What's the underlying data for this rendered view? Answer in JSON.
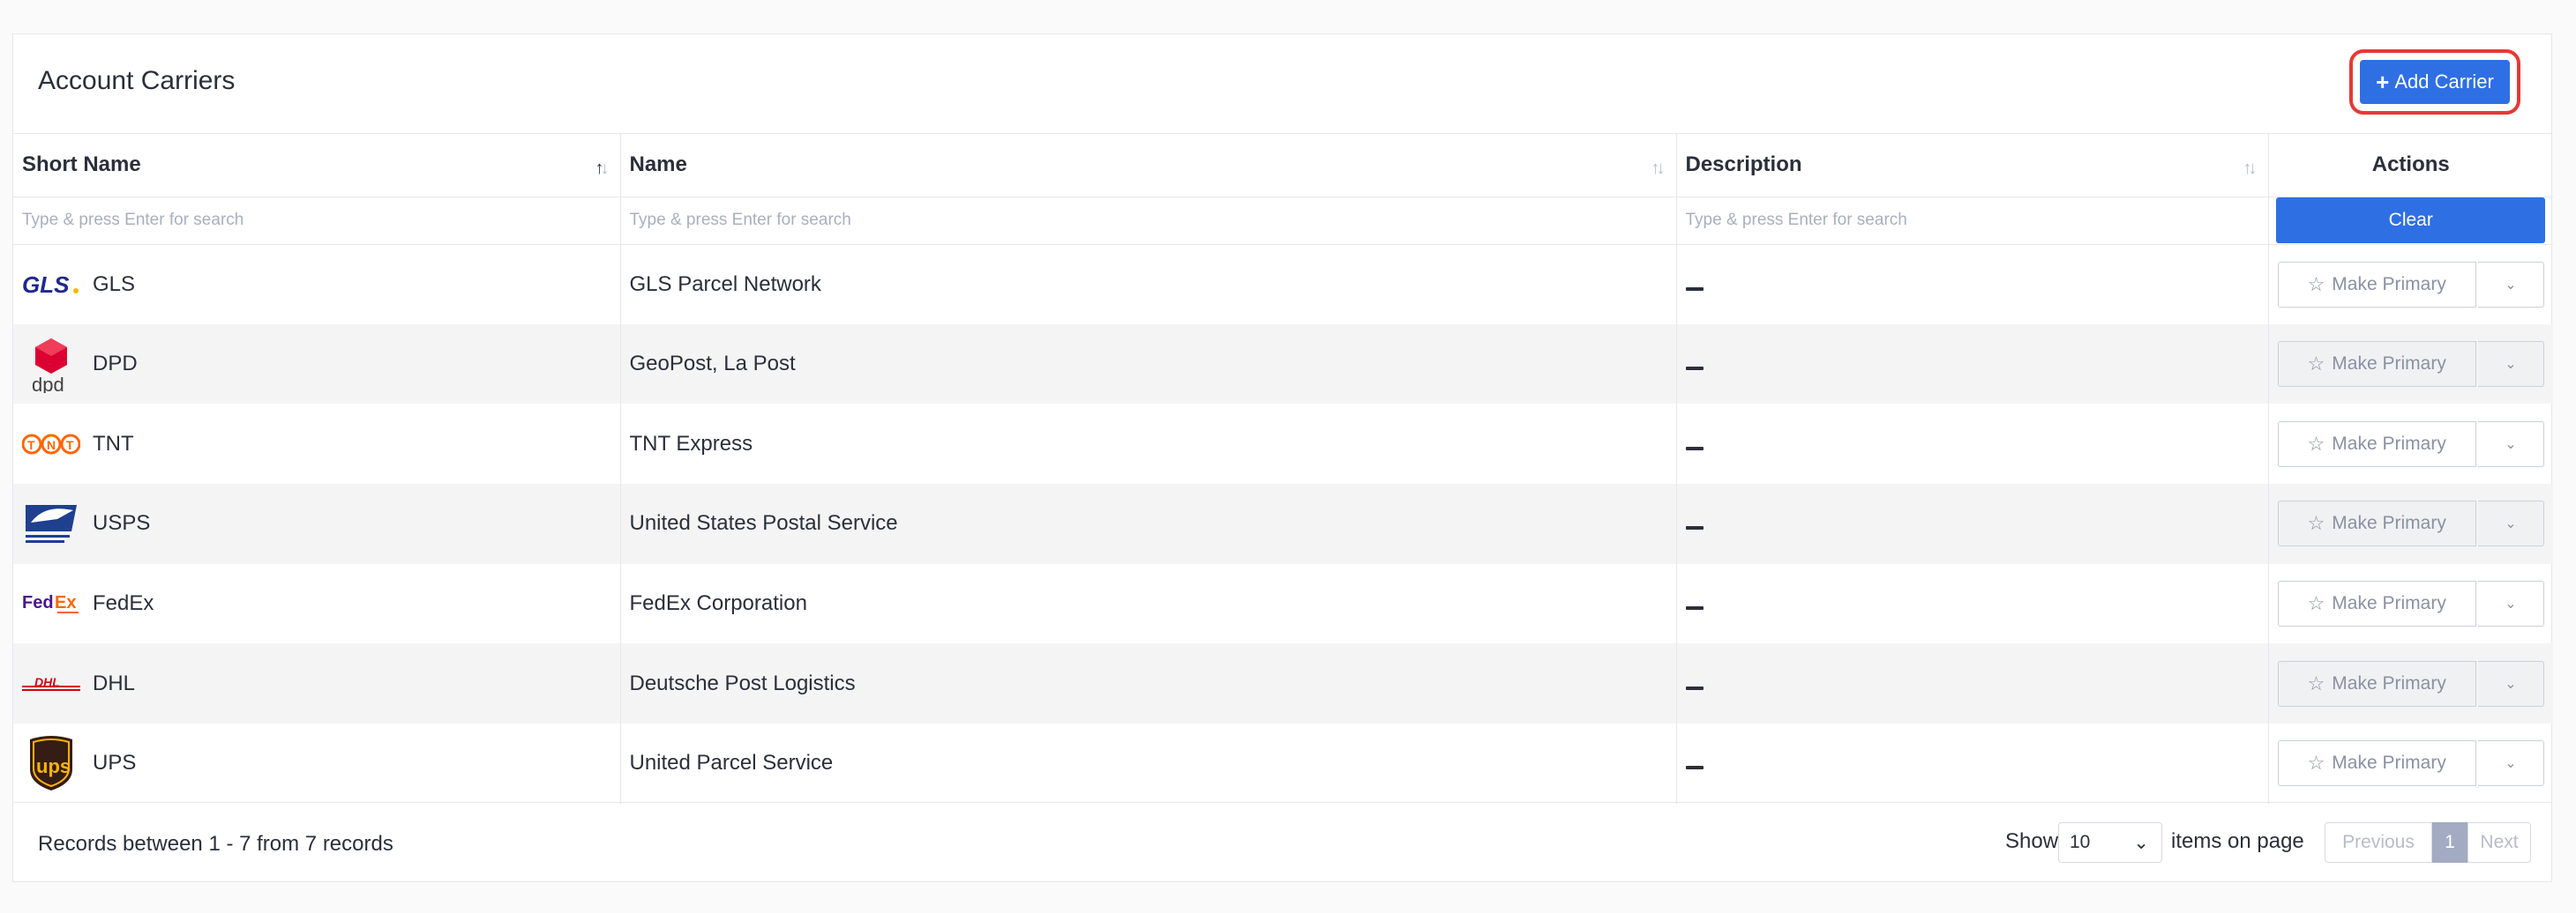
{
  "header": {
    "title": "Account Carriers",
    "add_button_label": "Add Carrier"
  },
  "table": {
    "columns": {
      "short_name": "Short Name",
      "name": "Name",
      "description": "Description",
      "actions": "Actions"
    },
    "filter_placeholder": "Type & press Enter for search",
    "clear_label": "Clear",
    "make_primary_label": "Make Primary",
    "rows": [
      {
        "short_name": "GLS",
        "name": "GLS Parcel Network",
        "logo": "gls-logo"
      },
      {
        "short_name": "DPD",
        "name": "GeoPost, La Post",
        "logo": "dpd-logo"
      },
      {
        "short_name": "TNT",
        "name": "TNT Express",
        "logo": "tnt-logo"
      },
      {
        "short_name": "USPS",
        "name": "United States Postal Service",
        "logo": "usps-logo"
      },
      {
        "short_name": "FedEx",
        "name": "FedEx Corporation",
        "logo": "fedex-logo"
      },
      {
        "short_name": "DHL",
        "name": "Deutsche Post Logistics",
        "logo": "dhl-logo"
      },
      {
        "short_name": "UPS",
        "name": "United Parcel Service",
        "logo": "ups-logo"
      }
    ]
  },
  "footer": {
    "records_text": "Records between 1 - 7 from 7 records",
    "show_label": "Show",
    "page_size": "10",
    "items_label": "items on page",
    "previous": "Previous",
    "current_page": "1",
    "next": "Next"
  },
  "colors": {
    "primary": "#2f6fe4",
    "highlight_outline": "#e53935"
  }
}
